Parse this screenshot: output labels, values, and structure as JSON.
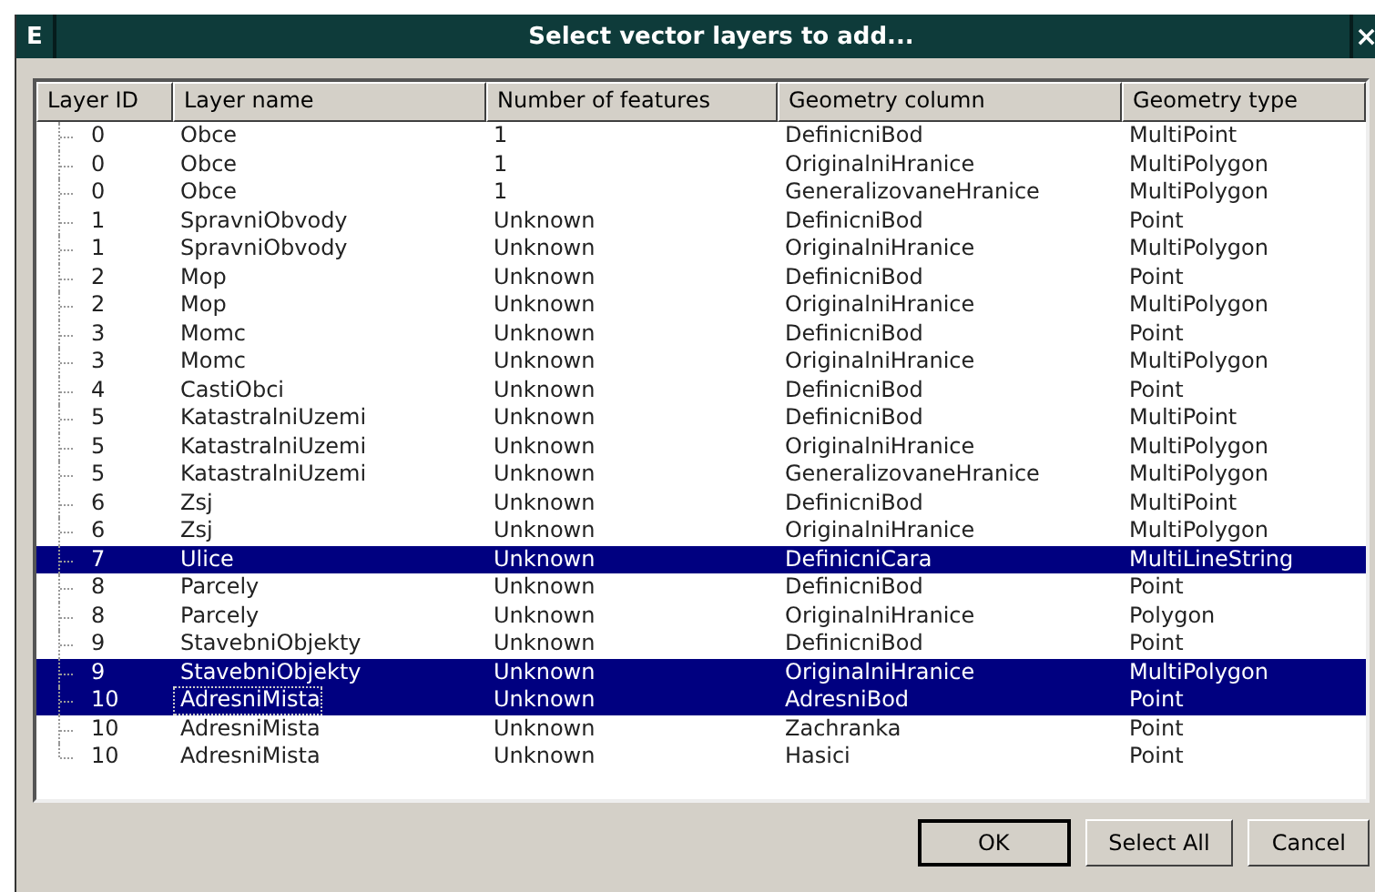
{
  "window": {
    "icon": "E",
    "title": "Select vector layers to add...",
    "close": "×"
  },
  "table": {
    "columns": [
      "Layer ID",
      "Layer name",
      "Number of features",
      "Geometry column",
      "Geometry type"
    ],
    "rows": [
      {
        "cells": [
          "0",
          "Obce",
          "1",
          "DefinicniBod",
          "MultiPoint"
        ],
        "selected": false,
        "focused": false
      },
      {
        "cells": [
          "0",
          "Obce",
          "1",
          "OriginalniHranice",
          "MultiPolygon"
        ],
        "selected": false,
        "focused": false
      },
      {
        "cells": [
          "0",
          "Obce",
          "1",
          "GeneralizovaneHranice",
          "MultiPolygon"
        ],
        "selected": false,
        "focused": false
      },
      {
        "cells": [
          "1",
          "SpravniObvody",
          "Unknown",
          "DefinicniBod",
          "Point"
        ],
        "selected": false,
        "focused": false
      },
      {
        "cells": [
          "1",
          "SpravniObvody",
          "Unknown",
          "OriginalniHranice",
          "MultiPolygon"
        ],
        "selected": false,
        "focused": false
      },
      {
        "cells": [
          "2",
          "Mop",
          "Unknown",
          "DefinicniBod",
          "Point"
        ],
        "selected": false,
        "focused": false
      },
      {
        "cells": [
          "2",
          "Mop",
          "Unknown",
          "OriginalniHranice",
          "MultiPolygon"
        ],
        "selected": false,
        "focused": false
      },
      {
        "cells": [
          "3",
          "Momc",
          "Unknown",
          "DefinicniBod",
          "Point"
        ],
        "selected": false,
        "focused": false
      },
      {
        "cells": [
          "3",
          "Momc",
          "Unknown",
          "OriginalniHranice",
          "MultiPolygon"
        ],
        "selected": false,
        "focused": false
      },
      {
        "cells": [
          "4",
          "CastiObci",
          "Unknown",
          "DefinicniBod",
          "Point"
        ],
        "selected": false,
        "focused": false
      },
      {
        "cells": [
          "5",
          "KatastralniUzemi",
          "Unknown",
          "DefinicniBod",
          "MultiPoint"
        ],
        "selected": false,
        "focused": false
      },
      {
        "cells": [
          "5",
          "KatastralniUzemi",
          "Unknown",
          "OriginalniHranice",
          "MultiPolygon"
        ],
        "selected": false,
        "focused": false
      },
      {
        "cells": [
          "5",
          "KatastralniUzemi",
          "Unknown",
          "GeneralizovaneHranice",
          "MultiPolygon"
        ],
        "selected": false,
        "focused": false
      },
      {
        "cells": [
          "6",
          "Zsj",
          "Unknown",
          "DefinicniBod",
          "MultiPoint"
        ],
        "selected": false,
        "focused": false
      },
      {
        "cells": [
          "6",
          "Zsj",
          "Unknown",
          "OriginalniHranice",
          "MultiPolygon"
        ],
        "selected": false,
        "focused": false
      },
      {
        "cells": [
          "7",
          "Ulice",
          "Unknown",
          "DefinicniCara",
          "MultiLineString"
        ],
        "selected": true,
        "focused": false
      },
      {
        "cells": [
          "8",
          "Parcely",
          "Unknown",
          "DefinicniBod",
          "Point"
        ],
        "selected": false,
        "focused": false
      },
      {
        "cells": [
          "8",
          "Parcely",
          "Unknown",
          "OriginalniHranice",
          "Polygon"
        ],
        "selected": false,
        "focused": false
      },
      {
        "cells": [
          "9",
          "StavebniObjekty",
          "Unknown",
          "DefinicniBod",
          "Point"
        ],
        "selected": false,
        "focused": false
      },
      {
        "cells": [
          "9",
          "StavebniObjekty",
          "Unknown",
          "OriginalniHranice",
          "MultiPolygon"
        ],
        "selected": true,
        "focused": false
      },
      {
        "cells": [
          "10",
          "AdresniMista",
          "Unknown",
          "AdresniBod",
          "Point"
        ],
        "selected": true,
        "focused": true
      },
      {
        "cells": [
          "10",
          "AdresniMista",
          "Unknown",
          "Zachranka",
          "Point"
        ],
        "selected": false,
        "focused": false
      },
      {
        "cells": [
          "10",
          "AdresniMista",
          "Unknown",
          "Hasici",
          "Point"
        ],
        "selected": false,
        "focused": false
      }
    ]
  },
  "buttons": [
    "OK",
    "Select All",
    "Cancel"
  ]
}
